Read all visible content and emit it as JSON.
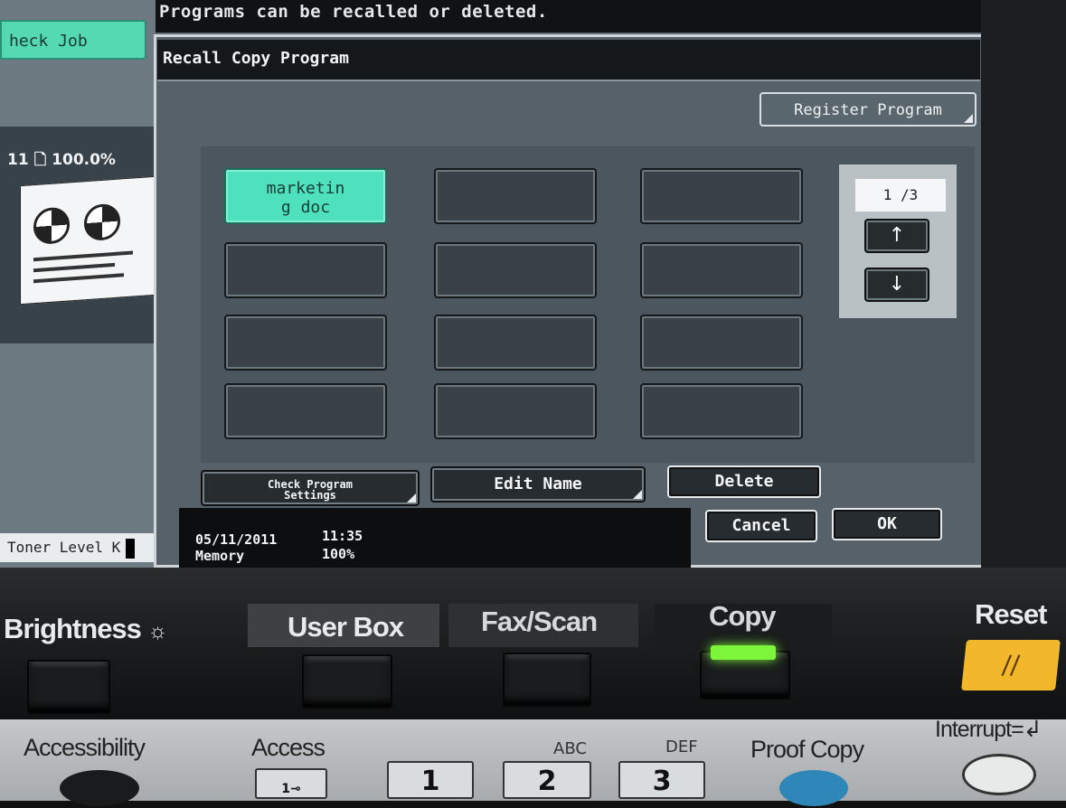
{
  "top_message": "Programs can be recalled or deleted.",
  "left_panel": {
    "check_job": "heck Job",
    "preview_header": "11 🗋 100.0%",
    "toner_label": "Toner Level",
    "toner_channel": "K"
  },
  "dialog": {
    "title": "Recall Copy Program",
    "register_button": "Register Program",
    "programs": [
      "marketin\ng doc",
      "",
      "",
      "",
      "",
      "",
      "",
      "",
      "",
      "",
      "",
      ""
    ],
    "page_indicator": "1 /3",
    "up_arrow": "↑",
    "down_arrow": "↓",
    "buttons": {
      "check_program_settings": "Check Program\nSettings",
      "edit_name": "Edit Name",
      "delete": "Delete",
      "cancel": "Cancel",
      "ok": "OK"
    }
  },
  "status": {
    "date": "05/11/2011",
    "time": "11:35",
    "memory_label": "Memory",
    "memory_value": "100%"
  },
  "hardware_panel": {
    "brightness": "Brightness",
    "brightness_icon": "sun-icon",
    "user_box": "User Box",
    "fax_scan": "Fax/Scan",
    "copy": "Copy",
    "copy_led_color": "#7df53a",
    "reset": "Reset",
    "reset_color": "#f2b72a",
    "accessibility": "Accessibility",
    "access": "Access",
    "abc": "ABC",
    "def": "DEF",
    "proof_copy": "Proof Copy",
    "interrupt": "Interrupt",
    "key_1": "1",
    "key_2": "2",
    "key_3": "3"
  }
}
